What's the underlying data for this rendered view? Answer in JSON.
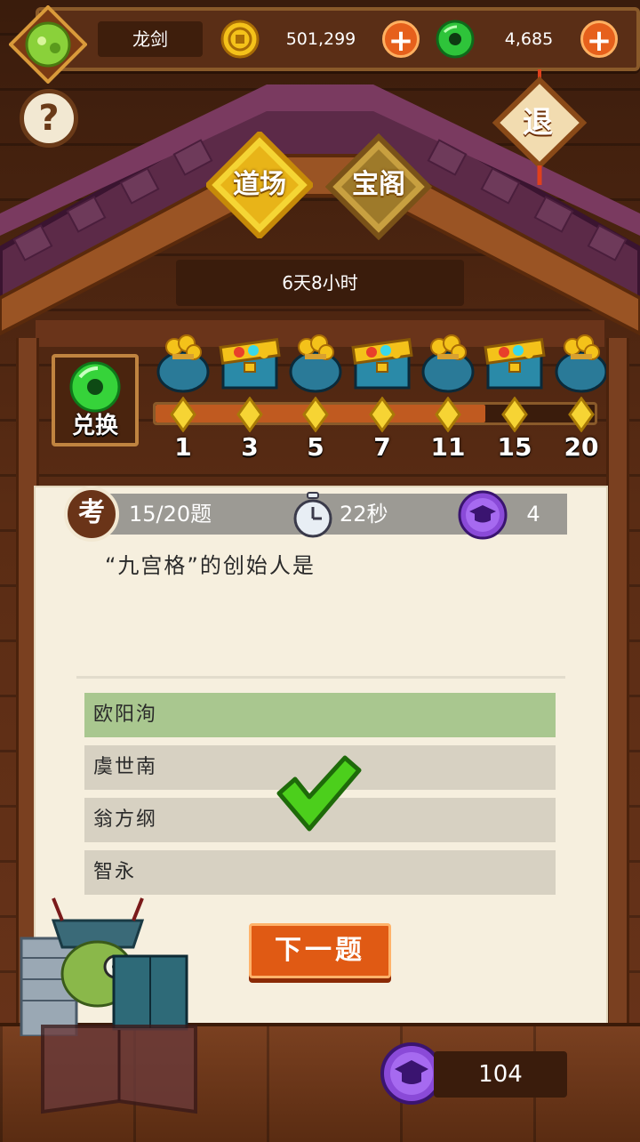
{
  "header": {
    "player_name": "龙剑",
    "coins": "501,299",
    "jade": "4,685"
  },
  "help_label": "?",
  "exit_label": "退",
  "tabs": [
    {
      "label": "道场",
      "active": true
    },
    {
      "label": "宝阁",
      "active": false
    }
  ],
  "timer": "6天8小时",
  "exchange_label": "兑换",
  "rewards": {
    "milestones": [
      "1",
      "3",
      "5",
      "7",
      "11",
      "15",
      "20"
    ],
    "chests": [
      "coin-bag-icon",
      "gem-box-icon",
      "coin-bag-icon",
      "jewel-chest-icon",
      "coin-bag-icon",
      "treasure-chest-icon",
      "coin-bag-icon"
    ],
    "progress_fraction": 0.75
  },
  "quiz": {
    "kao_label": "考",
    "progress": "15/20题",
    "time_left": "22秒",
    "caps": "4",
    "question": "“九宫格”的创始人是",
    "options": [
      "欧阳洵",
      "虞世南",
      "翁方纲",
      "智永"
    ],
    "selected_index": 0,
    "next_label": "下一题"
  },
  "bottom": {
    "caps_total": "104"
  },
  "colors": {
    "accent_orange": "#e05a14",
    "selected_option": "#a9c78f",
    "correct_check": "#4ccf1c"
  }
}
